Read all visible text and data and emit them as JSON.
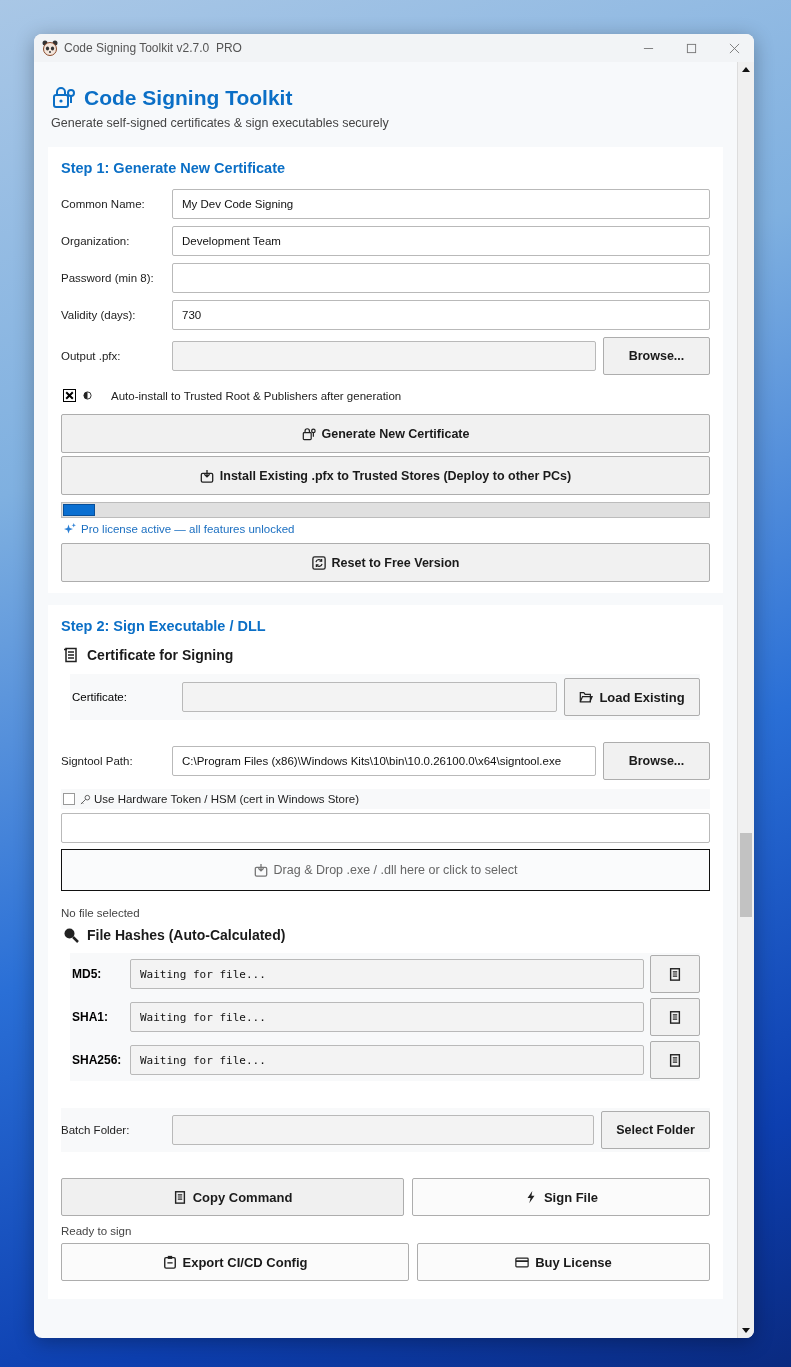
{
  "window": {
    "title": "Code Signing Toolkit v2.7.0  PRO"
  },
  "header": {
    "title": "Code Signing Toolkit",
    "subtitle": "Generate self-signed certificates & sign executables securely"
  },
  "step1": {
    "heading": "Step 1: Generate New Certificate",
    "fields": [
      {
        "label": "Common Name:",
        "value": "My Dev Code Signing",
        "readonly": false
      },
      {
        "label": "Organization:",
        "value": "Development Team",
        "readonly": false
      },
      {
        "label": "Password (min 8):",
        "readonly": false
      },
      {
        "label": "Validity (days):",
        "value": "730",
        "readonly": false
      },
      {
        "label": "Output .pfx:",
        "readonly": true,
        "button": "Browse..."
      }
    ],
    "auto_install": {
      "checked": true,
      "label": "Auto-install to Trusted Root & Publishers after generation"
    },
    "generate_button": "Generate New Certificate",
    "install_button": "Install Existing .pfx to Trusted Stores (Deploy to other PCs)",
    "progress": {
      "level": 0.05
    },
    "license_note": "Pro license active — all features unlocked",
    "reset_button": "Reset to Free Version"
  },
  "step2": {
    "heading": "Step 2: Sign Executable / DLL",
    "certificate_section": {
      "title": "Certificate for Signing",
      "label": "Certificate:",
      "button": "Load Existing"
    },
    "signtool": {
      "label": "Signtool Path:",
      "value": "C:\\Program Files (x86)\\Windows Kits\\10\\bin\\10.0.26100.0\\x64\\signtool.exe",
      "button": "Browse..."
    },
    "hardware_token": {
      "checked": false,
      "label": "Use Hardware Token / HSM (cert in Windows Store)"
    },
    "drop_zone": "Drag & Drop .exe / .dll here or click to select",
    "file_status": "No file selected",
    "hashes": {
      "title": "File Hashes (Auto-Calculated)",
      "rows": [
        {
          "label": "MD5:",
          "value": "Waiting for file..."
        },
        {
          "label": "SHA1:",
          "value": "Waiting for file..."
        },
        {
          "label": "SHA256:",
          "value": "Waiting for file..."
        }
      ]
    },
    "batch": {
      "label": "Batch Folder:",
      "button": "Select Folder"
    },
    "copy_button": "Copy Command",
    "sign_button": "Sign File",
    "status": "Ready to sign",
    "export_button": "Export CI/CD Config",
    "buy_button": "Buy License"
  }
}
